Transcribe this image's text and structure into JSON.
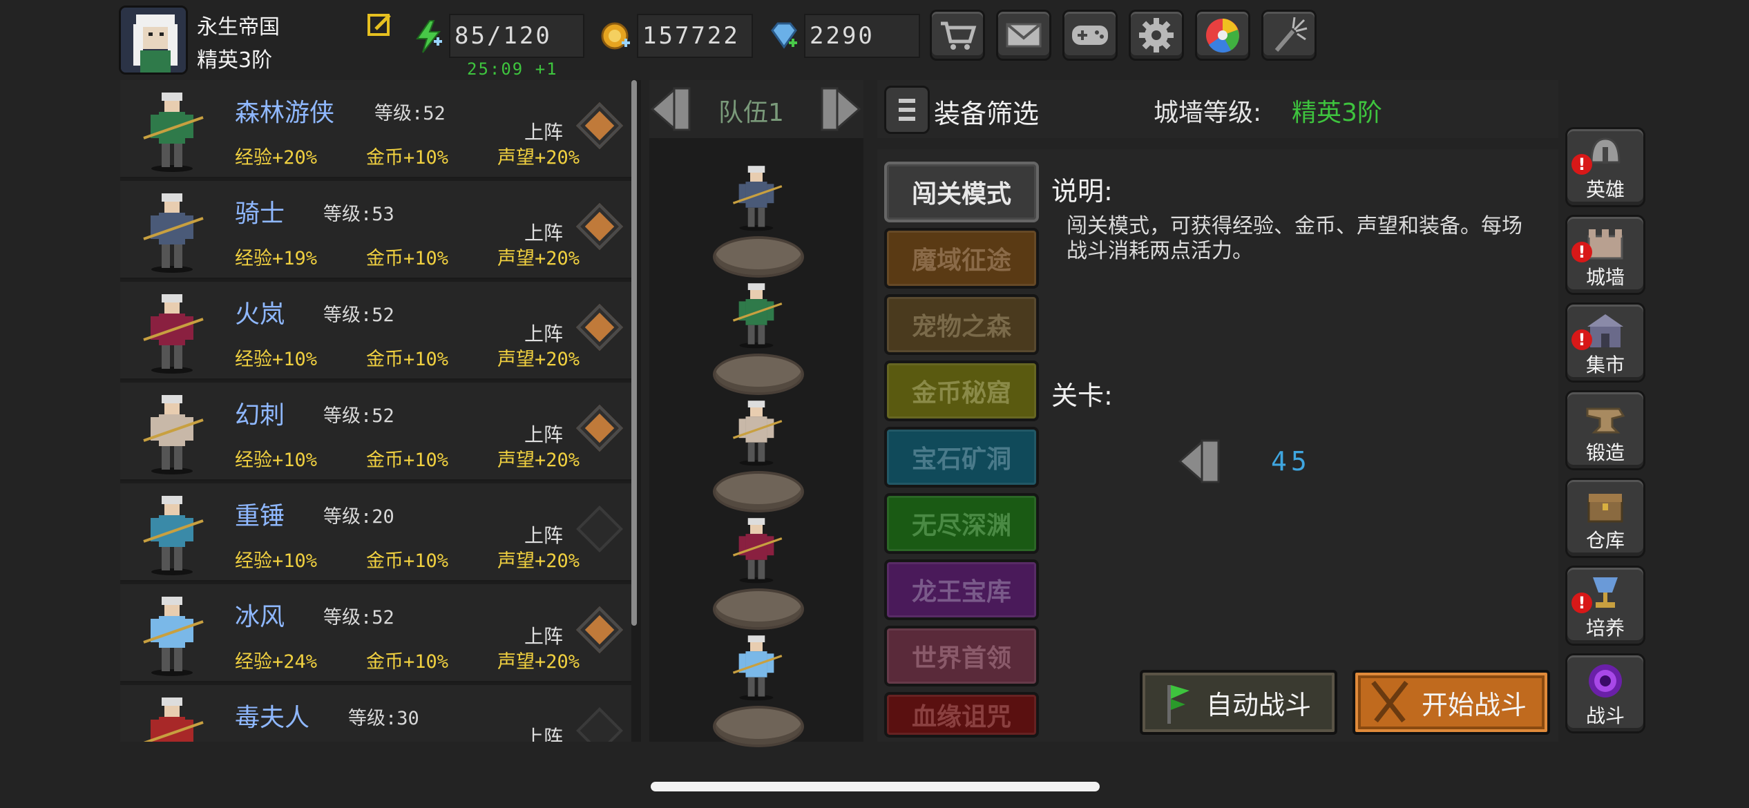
{
  "player": {
    "empire_name": "永生帝国",
    "rank": "精英3阶"
  },
  "resources": {
    "stamina": "85/120",
    "stamina_timer": "25:09 +1",
    "gold": "157722",
    "gems": "2290"
  },
  "top_buttons": [
    "cart-icon",
    "mail-icon",
    "gamepad-icon",
    "gear-icon",
    "color-wheel-icon",
    "firework-icon"
  ],
  "heroes": [
    {
      "name": "森林游侠",
      "level": "等级:52",
      "exp": "经验+20%",
      "gold": "金币+10%",
      "fame": "声望+20%",
      "deploy": "上阵",
      "deployed": true,
      "color": "#2f7a4a"
    },
    {
      "name": "骑士",
      "level": "等级:53",
      "exp": "经验+19%",
      "gold": "金币+10%",
      "fame": "声望+20%",
      "deploy": "上阵",
      "deployed": true,
      "color": "#4a5a78"
    },
    {
      "name": "火岚",
      "level": "等级:52",
      "exp": "经验+10%",
      "gold": "金币+10%",
      "fame": "声望+20%",
      "deploy": "上阵",
      "deployed": true,
      "color": "#8a2040"
    },
    {
      "name": "幻刺",
      "level": "等级:52",
      "exp": "经验+10%",
      "gold": "金币+10%",
      "fame": "声望+20%",
      "deploy": "上阵",
      "deployed": true,
      "color": "#c8b8a8"
    },
    {
      "name": "重锤",
      "level": "等级:20",
      "exp": "经验+10%",
      "gold": "金币+10%",
      "fame": "声望+20%",
      "deploy": "上阵",
      "deployed": false,
      "color": "#3a8aa8"
    },
    {
      "name": "冰风",
      "level": "等级:52",
      "exp": "经验+24%",
      "gold": "金币+10%",
      "fame": "声望+20%",
      "deploy": "上阵",
      "deployed": true,
      "color": "#7ab8e8"
    },
    {
      "name": "毒夫人",
      "level": "等级:30",
      "exp": "",
      "gold": "",
      "fame": "",
      "deploy": "上阵",
      "deployed": false,
      "color": "#a82828"
    }
  ],
  "team": {
    "label": "队伍1",
    "members": [
      "#4a5a78",
      "#2f7a4a",
      "#c8b8a8",
      "#8a2040",
      "#7ab8e8"
    ]
  },
  "filter": {
    "label": "装备筛选",
    "wall_label": "城墙等级:",
    "wall_value": "精英3阶"
  },
  "modes": [
    {
      "label": "闯关模式",
      "bg": "#3a3a3a",
      "fg": "#e8e8e8",
      "active": true
    },
    {
      "label": "魔域征途",
      "bg": "#5a3a14",
      "fg": "#8a6a48",
      "active": false
    },
    {
      "label": "宠物之森",
      "bg": "#4a3a1e",
      "fg": "#7a6a4a",
      "active": false
    },
    {
      "label": "金币秘窟",
      "bg": "#5a5a10",
      "fg": "#8a8a48",
      "active": false
    },
    {
      "label": "宝石矿洞",
      "bg": "#104a5a",
      "fg": "#4a7a8a",
      "active": false
    },
    {
      "label": "无尽深渊",
      "bg": "#1a5a14",
      "fg": "#4a8a44",
      "active": false
    },
    {
      "label": "龙王宝库",
      "bg": "#4a1a5a",
      "fg": "#7a5a8a",
      "active": false
    },
    {
      "label": "世界首领",
      "bg": "#5a2a3a",
      "fg": "#8a5a6a",
      "active": false
    },
    {
      "label": "血缘诅咒",
      "bg": "#5a1010",
      "fg": "#8a4040",
      "active": false
    }
  ],
  "description": {
    "title": "说明:",
    "text": "闯关模式，可获得经验、金币、声望和装备。每场战斗消耗两点活力。"
  },
  "stage": {
    "title": "关卡:",
    "value": "45"
  },
  "actions": {
    "auto_battle": "自动战斗",
    "start_battle": "开始战斗"
  },
  "sidebar": [
    {
      "label": "英雄",
      "icon": "helmet-icon",
      "alert": true
    },
    {
      "label": "城墙",
      "icon": "wall-icon",
      "alert": true
    },
    {
      "label": "集市",
      "icon": "market-icon",
      "alert": true
    },
    {
      "label": "锻造",
      "icon": "anvil-icon",
      "alert": false
    },
    {
      "label": "仓库",
      "icon": "chest-icon",
      "alert": false
    },
    {
      "label": "培养",
      "icon": "chalice-icon",
      "alert": true
    },
    {
      "label": "战斗",
      "icon": "portal-icon",
      "alert": false
    }
  ],
  "alert_glyph": "!"
}
